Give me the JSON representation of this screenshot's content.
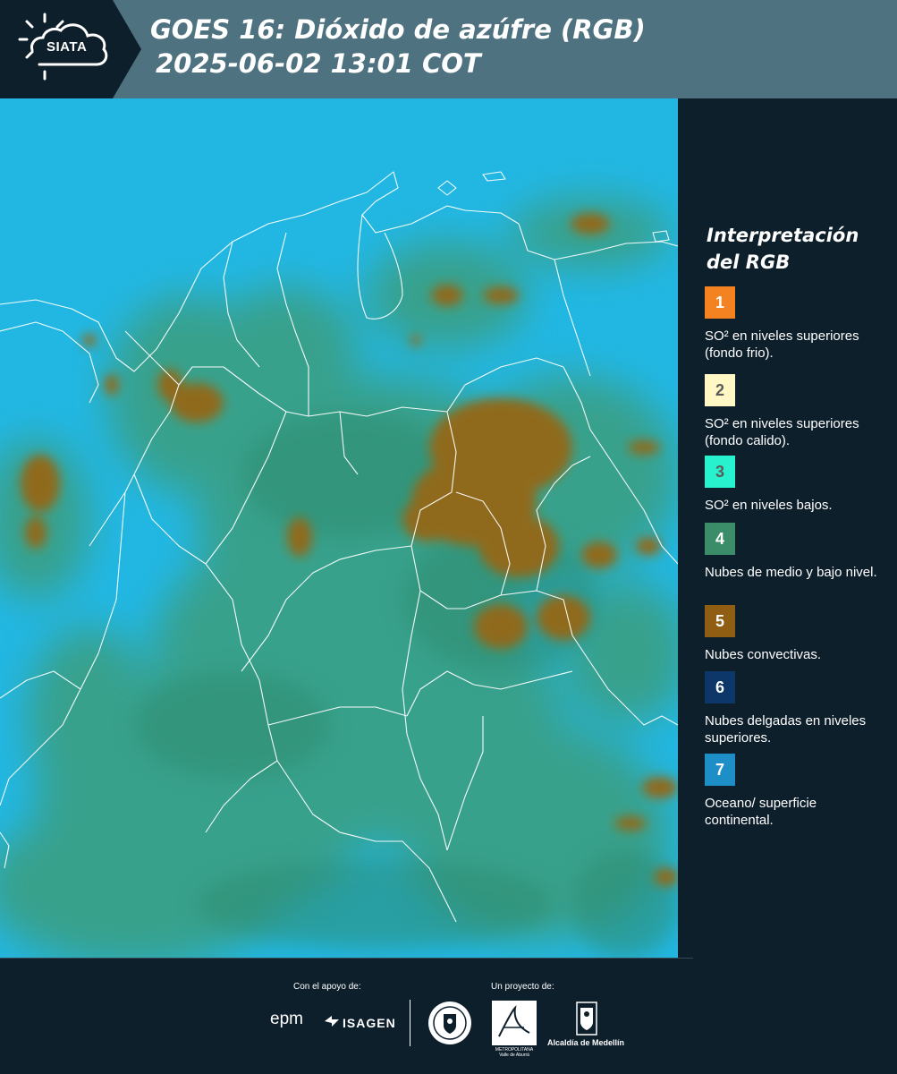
{
  "header": {
    "logo_text": "SIATA",
    "title_line1": "GOES 16: Dióxido de azúfre (RGB)",
    "title_line2": "2025-06-02 13:01 COT"
  },
  "legend": {
    "title": "Interpretación del RGB",
    "items": [
      {
        "number": "1",
        "color": "#f58220",
        "text": "SO² en niveles superiores (fondo frio)."
      },
      {
        "number": "2",
        "color": "#fff8c4",
        "text": "SO² en niveles superiores (fondo calido)."
      },
      {
        "number": "3",
        "color": "#27f2cd",
        "text": "SO² en niveles bajos."
      },
      {
        "number": "4",
        "color": "#3a8d68",
        "text": "Nubes de medio y bajo nivel."
      },
      {
        "number": "5",
        "color": "#8f5e13",
        "text": "Nubes convectivas."
      },
      {
        "number": "6",
        "color": "#0d3769",
        "text": "Nubes delgadas en niveles superiores."
      },
      {
        "number": "7",
        "color": "#1e8fc6",
        "text": "Oceano/ superficie continental."
      }
    ]
  },
  "footer": {
    "support_label": "Con el apoyo de:",
    "project_label": "Un proyecto de:",
    "epm_text": "epm",
    "isagen_text": "ISAGEN",
    "metro_caption": "METROPOLITANA Valle de Aburrá",
    "alcaldia_text": "Alcaldía de Medellín"
  },
  "colors": {
    "header_bg": "#4f7281",
    "panel_bg": "#0e1f2c",
    "background_cyan": "#22b7e3",
    "green_cloud": "#3f9a6f",
    "brown_cloud": "#8f6a1a"
  }
}
